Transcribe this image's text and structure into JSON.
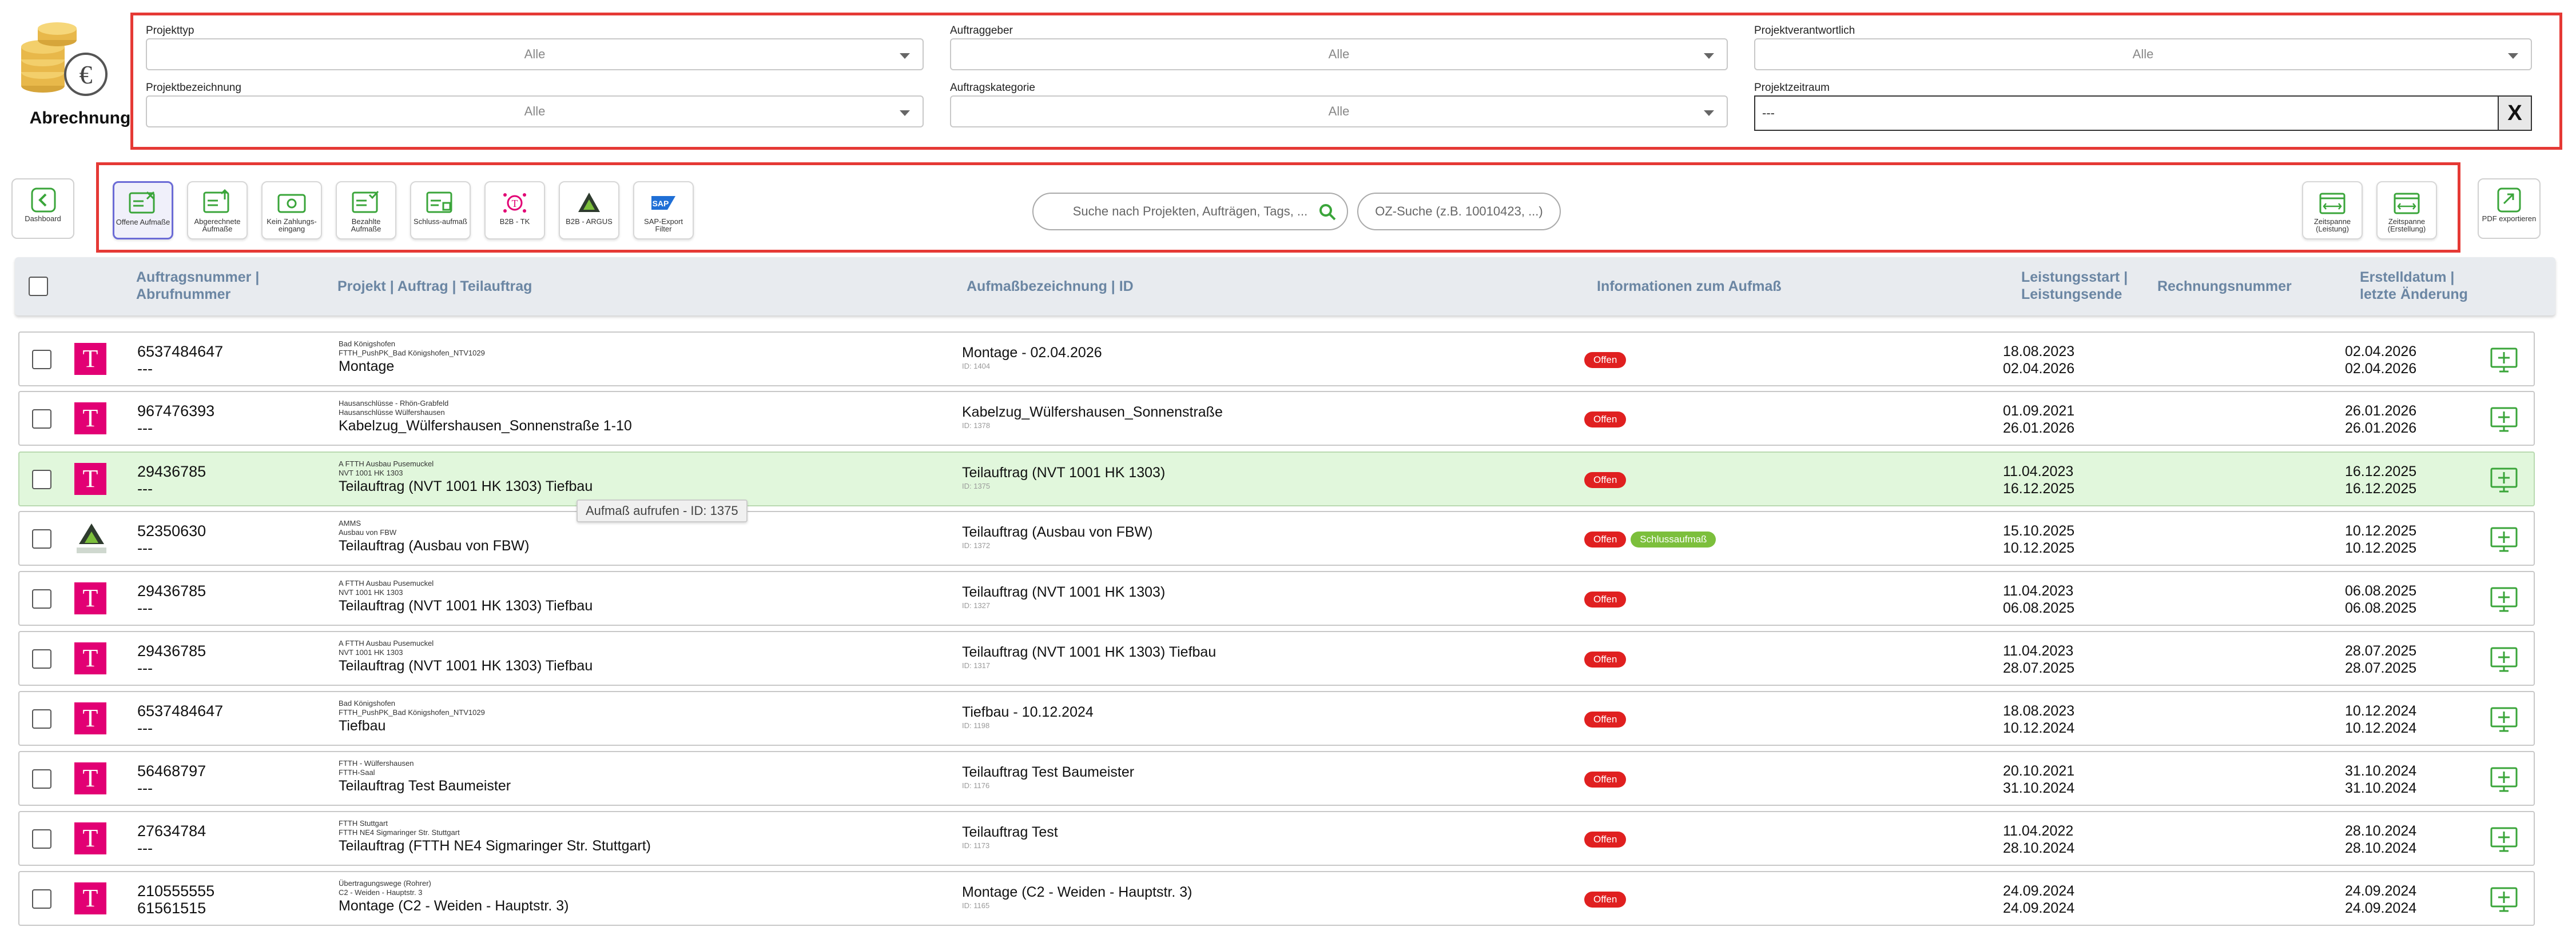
{
  "app": {
    "title": "Abrechnung"
  },
  "filters": {
    "projekttyp": {
      "label": "Projekttyp",
      "value": "Alle"
    },
    "auftraggeber": {
      "label": "Auftraggeber",
      "value": "Alle"
    },
    "projektverantwortlich": {
      "label": "Projektverantwortlich",
      "value": "Alle"
    },
    "projektbezeichnung": {
      "label": "Projektbezeichnung",
      "value": "Alle"
    },
    "auftragskategorie": {
      "label": "Auftragskategorie",
      "value": "Alle"
    },
    "projektzeitraum": {
      "label": "Projektzeitraum",
      "value": "---",
      "clear_label": "X"
    }
  },
  "toolbar": {
    "dashboard": "Dashboard",
    "offene": "Offene Aufmaße",
    "abgerechnete": "Abgerechnete Aufmaße",
    "kein_zahlung": "Kein Zahlungs-eingang",
    "bezahlte": "Bezahlte Aufmaße",
    "schluss": "Schluss-aufmaß",
    "b2b_tk": "B2B - TK",
    "b2b_argus": "B2B - ARGUS",
    "sap_export": "SAP-Export Filter",
    "search_placeholder": "Suche nach Projekten, Aufträgen, Tags, ...",
    "oz_placeholder": "OZ-Suche (z.B. 10010423, ...)",
    "zeitspanne_leistung": "Zeitspanne (Leistung)",
    "zeitspanne_erstellung": "Zeitspanne (Erstellung)",
    "pdf_export": "PDF exportieren"
  },
  "columns": {
    "auftragsnummer": "Auftragsnummer |",
    "abrufnummer": "Abrufnummer",
    "projekt": "Projekt | Auftrag | Teilauftrag",
    "aufmass": "Aufmaßbezeichnung | ID",
    "informationen": "Informationen zum Aufmaß",
    "leistungsstart": "Leistungsstart |",
    "leistungsende": "Leistungsende",
    "rechnungsnummer": "Rechnungsnummer",
    "erstelldatum": "Erstelldatum |",
    "letzte_aenderung": "letzte Änderung"
  },
  "rows": [
    {
      "logo": "telekom",
      "auftragsnummer": "6537484647",
      "abrufnummer": "---",
      "projekt": "Bad Königshofen",
      "auftrag": "FTTH_PushPK_Bad Königshofen_NTV1029",
      "teilauftrag": "Montage",
      "aufmass": "Montage - 02.04.2026",
      "id": "ID: 1404",
      "status": "Offen",
      "extra_badge": "",
      "start": "18.08.2023",
      "ende": "02.04.2026",
      "erstellt": "02.04.2026",
      "geaendert": "02.04.2026"
    },
    {
      "logo": "telekom",
      "auftragsnummer": "967476393",
      "abrufnummer": "---",
      "projekt": "Hausanschlüsse - Rhön-Grabfeld",
      "auftrag": "Hausanschlüsse Wülfershausen",
      "teilauftrag": "Kabelzug_Wülfershausen_Sonnenstraße 1-10",
      "aufmass": "Kabelzug_Wülfershausen_Sonnenstraße",
      "id": "ID: 1378",
      "status": "Offen",
      "extra_badge": "",
      "start": "01.09.2021",
      "ende": "26.01.2026",
      "erstellt": "26.01.2026",
      "geaendert": "26.01.2026"
    },
    {
      "logo": "telekom",
      "auftragsnummer": "29436785",
      "abrufnummer": "---",
      "projekt": "A FTTH Ausbau Pusemuckel",
      "auftrag": "NVT 1001 HK 1303",
      "teilauftrag": "Teilauftrag (NVT 1001 HK 1303) Tiefbau",
      "aufmass": "Teilauftrag (NVT 1001 HK 1303)",
      "id": "ID: 1375",
      "status": "Offen",
      "extra_badge": "",
      "start": "11.04.2023",
      "ende": "16.12.2025",
      "erstellt": "16.12.2025",
      "geaendert": "16.12.2025"
    },
    {
      "logo": "argus",
      "auftragsnummer": "52350630",
      "abrufnummer": "---",
      "projekt": "AMMS",
      "auftrag": "Ausbau von FBW",
      "teilauftrag": "Teilauftrag (Ausbau von FBW)",
      "aufmass": "Teilauftrag (Ausbau von FBW)",
      "id": "ID: 1372",
      "status": "Offen",
      "extra_badge": "Schlussaufmaß",
      "start": "15.10.2025",
      "ende": "10.12.2025",
      "erstellt": "10.12.2025",
      "geaendert": "10.12.2025"
    },
    {
      "logo": "telekom",
      "auftragsnummer": "29436785",
      "abrufnummer": "---",
      "projekt": "A FTTH Ausbau Pusemuckel",
      "auftrag": "NVT 1001 HK 1303",
      "teilauftrag": "Teilauftrag (NVT 1001 HK 1303) Tiefbau",
      "aufmass": "Teilauftrag (NVT 1001 HK 1303)",
      "id": "ID: 1327",
      "status": "Offen",
      "extra_badge": "",
      "start": "11.04.2023",
      "ende": "06.08.2025",
      "erstellt": "06.08.2025",
      "geaendert": "06.08.2025"
    },
    {
      "logo": "telekom",
      "auftragsnummer": "29436785",
      "abrufnummer": "---",
      "projekt": "A FTTH Ausbau Pusemuckel",
      "auftrag": "NVT 1001 HK 1303",
      "teilauftrag": "Teilauftrag (NVT 1001 HK 1303) Tiefbau",
      "aufmass": "Teilauftrag (NVT 1001 HK 1303) Tiefbau",
      "id": "ID: 1317",
      "status": "Offen",
      "extra_badge": "",
      "start": "11.04.2023",
      "ende": "28.07.2025",
      "erstellt": "28.07.2025",
      "geaendert": "28.07.2025"
    },
    {
      "logo": "telekom",
      "auftragsnummer": "6537484647",
      "abrufnummer": "---",
      "projekt": "Bad Königshofen",
      "auftrag": "FTTH_PushPK_Bad Königshofen_NTV1029",
      "teilauftrag": "Tiefbau",
      "aufmass": "Tiefbau - 10.12.2024",
      "id": "ID: 1198",
      "status": "Offen",
      "extra_badge": "",
      "start": "18.08.2023",
      "ende": "10.12.2024",
      "erstellt": "10.12.2024",
      "geaendert": "10.12.2024"
    },
    {
      "logo": "telekom",
      "auftragsnummer": "56468797",
      "abrufnummer": "---",
      "projekt": "FTTH - Wülfershausen",
      "auftrag": "FTTH-Saal",
      "teilauftrag": "Teilauftrag Test Baumeister",
      "aufmass": "Teilauftrag Test Baumeister",
      "id": "ID: 1176",
      "status": "Offen",
      "extra_badge": "",
      "start": "20.10.2021",
      "ende": "31.10.2024",
      "erstellt": "31.10.2024",
      "geaendert": "31.10.2024"
    },
    {
      "logo": "telekom",
      "auftragsnummer": "27634784",
      "abrufnummer": "---",
      "projekt": "FTTH Stuttgart",
      "auftrag": "FTTH NE4 Sigmaringer Str. Stuttgart",
      "teilauftrag": "Teilauftrag (FTTH NE4 Sigmaringer Str. Stuttgart)",
      "aufmass": "Teilauftrag Test",
      "id": "ID: 1173",
      "status": "Offen",
      "extra_badge": "",
      "start": "11.04.2022",
      "ende": "28.10.2024",
      "erstellt": "28.10.2024",
      "geaendert": "28.10.2024"
    },
    {
      "logo": "telekom",
      "auftragsnummer": "210555555",
      "abrufnummer": "61561515",
      "projekt": "Übertragungswege (Rohrer)",
      "auftrag": "C2 - Weiden - Hauptstr. 3",
      "teilauftrag": "Montage (C2 - Weiden - Hauptstr. 3)",
      "aufmass": "Montage (C2 - Weiden - Hauptstr. 3)",
      "id": "ID: 1165",
      "status": "Offen",
      "extra_badge": "",
      "start": "24.09.2024",
      "ende": "24.09.2024",
      "erstellt": "24.09.2024",
      "geaendert": "24.09.2024"
    }
  ],
  "tooltip": "Aufmaß aufrufen - ID: 1375",
  "colors": {
    "accent_red": "#e53935",
    "badge_offen": "#e02020",
    "badge_schluss": "#7cbf3c",
    "telekom_magenta": "#e20074",
    "icon_green": "#3aa53a",
    "header_text": "#6b86a3",
    "hover_row": "#e1f7dc"
  }
}
